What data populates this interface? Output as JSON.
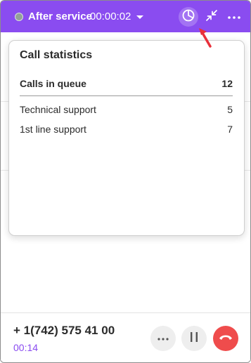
{
  "header": {
    "status_label": "After service",
    "status_timer": "00:00:02",
    "accent_color": "#8a4cf0",
    "status_dot_color": "#93a19a",
    "icons": [
      "chevron-down-icon",
      "pie-chart-icon",
      "collapse-icon",
      "more-horizontal-icon"
    ]
  },
  "call_statistics": {
    "title": "Call statistics",
    "total": {
      "label": "Calls in queue",
      "value": "12"
    },
    "queues": [
      {
        "label": "Technical support",
        "value": "5"
      },
      {
        "label": "1st line support",
        "value": "7"
      }
    ]
  },
  "call_bar": {
    "phone_number": "+ 1(742) 575 41 00",
    "duration": "00:14",
    "hangup_color": "#ef4c4c",
    "icons": [
      "more-horizontal-icon",
      "pause-icon",
      "hang-up-icon"
    ]
  }
}
